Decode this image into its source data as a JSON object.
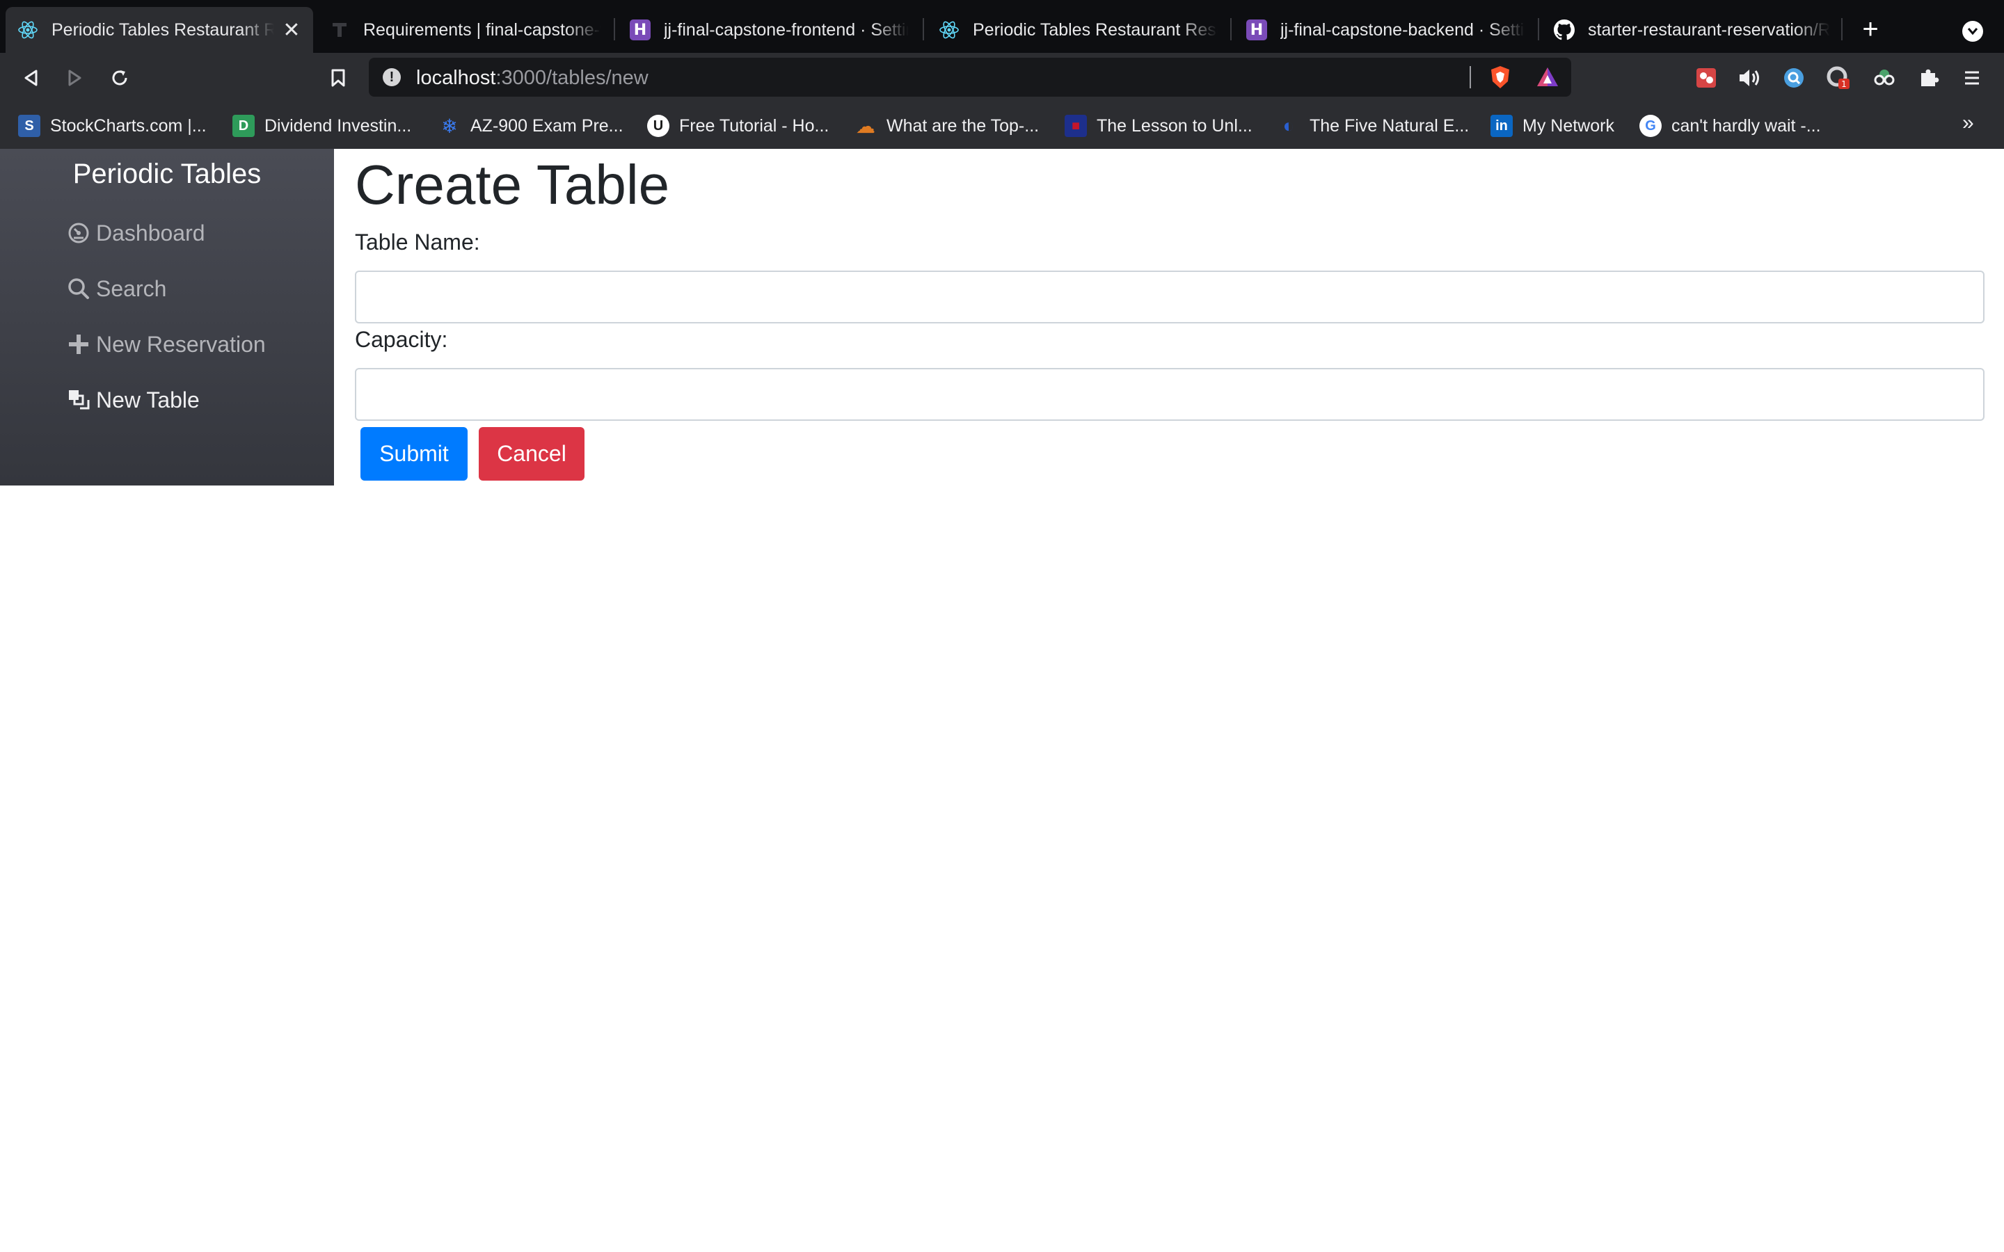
{
  "browser": {
    "tabs": [
      {
        "title": "Periodic Tables Restaurant Reservation",
        "icon": "react-icon",
        "active": true
      },
      {
        "title": "Requirements | final-capstone-v",
        "icon": "thinkful-icon"
      },
      {
        "title": "jj-final-capstone-frontend · Settings",
        "icon": "heroku-icon"
      },
      {
        "title": "Periodic Tables Restaurant Reservation",
        "icon": "react-icon"
      },
      {
        "title": "jj-final-capstone-backend · Settings",
        "icon": "heroku-icon"
      },
      {
        "title": "starter-restaurant-reservation/R",
        "icon": "github-icon"
      }
    ],
    "close_glyph": "✕",
    "new_tab_glyph": "+",
    "url": {
      "host": "localhost",
      "path": ":3000/tables/new"
    },
    "extension_badge": "1",
    "bookmarks": [
      {
        "label": "StockCharts.com |...",
        "color": "#2f5fa8",
        "glyph": "S"
      },
      {
        "label": "Dividend Investin...",
        "color": "#2e9b5a",
        "glyph": "D"
      },
      {
        "label": "AZ-900 Exam Pre...",
        "color": "#2c6bd6",
        "glyph": "❄"
      },
      {
        "label": "Free Tutorial - Ho...",
        "color": "#ffffff",
        "glyph": "U"
      },
      {
        "label": "What are the Top-...",
        "color": "#e07b22",
        "glyph": "☁"
      },
      {
        "label": "The Lesson to Unl...",
        "color": "#c4162a",
        "glyph": "■"
      },
      {
        "label": "The Five Natural E...",
        "color": "#1e4fb8",
        "glyph": "◐"
      },
      {
        "label": "My Network",
        "color": "#0a66c2",
        "glyph": "in"
      },
      {
        "label": "can't hardly wait -...",
        "color": "#ffffff",
        "glyph": "G"
      }
    ],
    "bookmarks_more": "»"
  },
  "sidebar": {
    "brand": "Periodic Tables",
    "items": [
      {
        "label": "Dashboard",
        "icon": "dashboard-icon"
      },
      {
        "label": "Search",
        "icon": "search-icon"
      },
      {
        "label": "New Reservation",
        "icon": "plus-icon"
      },
      {
        "label": "New Table",
        "icon": "layers-icon"
      }
    ]
  },
  "form": {
    "title": "Create Table",
    "fields": [
      {
        "label": "Table Name:",
        "value": "",
        "placeholder": ""
      },
      {
        "label": "Capacity:",
        "value": "",
        "placeholder": ""
      }
    ],
    "submit_label": "Submit",
    "cancel_label": "Cancel"
  },
  "colors": {
    "submit": "#007bff",
    "cancel": "#dc3545",
    "sidebar_top": "#4a4c55",
    "sidebar_bottom": "#34363d"
  }
}
